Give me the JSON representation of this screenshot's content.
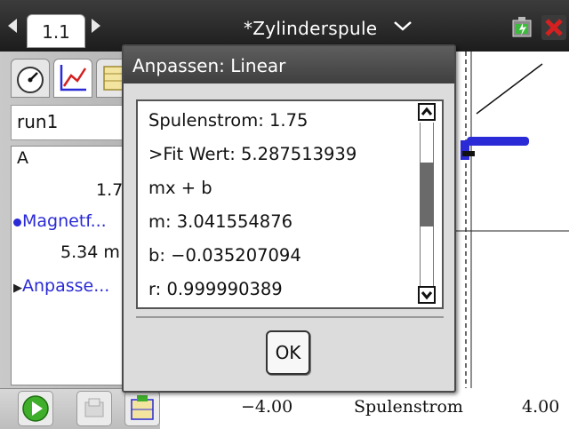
{
  "header": {
    "page_tab": "1.1",
    "doc_title": "*Zylinderspule"
  },
  "left_panel": {
    "run": "run1",
    "meter_header": "A",
    "strom_value": "1.7",
    "magnet_label": "Magnetf...",
    "magnet_value": "5.34 m",
    "fit_label": "Anpasse..."
  },
  "dialog": {
    "title": "Anpassen: Linear",
    "lines": [
      "Spulenstrom: 1.75",
      ">Fit Wert: 5.287513939",
      "mx + b",
      "m: 3.041554876",
      "b: −0.035207094",
      "r: 0.999990389"
    ],
    "ok_label": "OK",
    "scroll_fraction": 0.4
  },
  "graph": {
    "x_min_label": "−4.00",
    "x_axis_label": "Spulenstrom",
    "x_max_label": "4.00",
    "series_color": "#2a2ad6",
    "fit_color": "#111111"
  },
  "colors": {
    "close": "#d42020",
    "accent_blue": "#2a2ad6"
  },
  "icons": {
    "meter_tab": "gauge-icon",
    "graph_tab": "graph-icon",
    "table_tab": "table-icon",
    "play": "play-icon",
    "store": "store-icon",
    "graph_tool": "graph-tool-icon"
  }
}
